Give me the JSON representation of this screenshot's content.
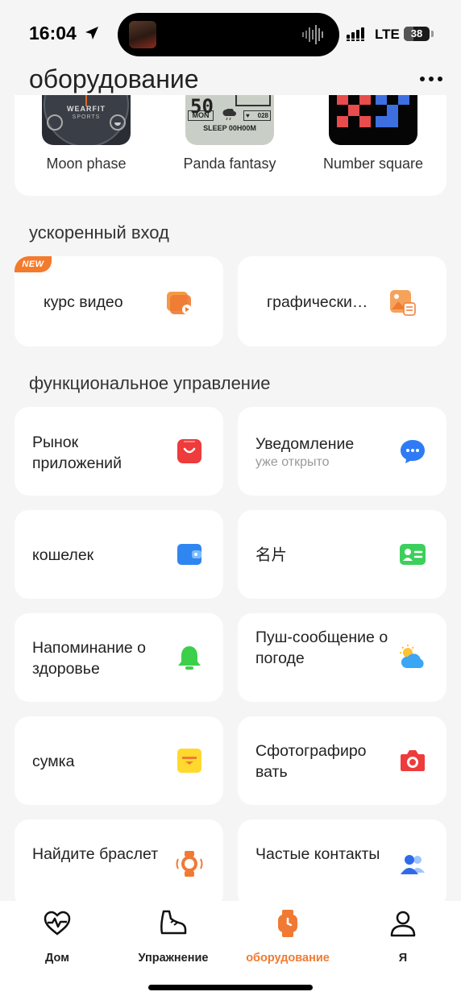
{
  "status": {
    "time": "16:04",
    "network": "LTE",
    "battery": "38",
    "battery_level": 0.38
  },
  "header": {
    "title": "оборудование"
  },
  "watch_faces": [
    {
      "label": "Moon phase",
      "brand": "WEARFIT",
      "sub": "SPORTS"
    },
    {
      "label": "Panda fantasy",
      "digits": "50",
      "day": "MON",
      "num": "028",
      "sleep": "SLEEP 00H00M"
    },
    {
      "label": "Number square"
    }
  ],
  "quick_entry": {
    "title": "ускоренный вход",
    "badge": "NEW",
    "items": [
      {
        "label": "курс видео"
      },
      {
        "label": "графически…"
      }
    ]
  },
  "functions": {
    "title": "функциональное управление",
    "items": [
      {
        "label": "Рынок приложений",
        "icon": "app-market-icon"
      },
      {
        "label": "Уведомление",
        "sub": "уже открыто",
        "icon": "chat-bubble-icon"
      },
      {
        "label": "кошелек",
        "icon": "wallet-icon"
      },
      {
        "label": "名片",
        "icon": "contact-card-icon"
      },
      {
        "label": "Напоминание о здоровье",
        "icon": "bell-icon"
      },
      {
        "label": "Пуш-сообщение о погоде",
        "icon": "weather-icon"
      },
      {
        "label": "сумка",
        "icon": "bag-icon"
      },
      {
        "label": "Сфотографиро вать",
        "icon": "camera-icon"
      },
      {
        "label": "Найдите браслет",
        "icon": "find-watch-icon"
      },
      {
        "label": "Частые контакты",
        "icon": "contacts-icon"
      }
    ]
  },
  "nav": {
    "active": "оборудование",
    "items": [
      {
        "label": "Дом",
        "icon": "heart-pulse-icon"
      },
      {
        "label": "Упражнение",
        "icon": "shoe-icon"
      },
      {
        "label": "оборудование",
        "icon": "watch-icon"
      },
      {
        "label": "Я",
        "icon": "person-icon"
      }
    ]
  },
  "colors": {
    "accent": "#f07a33",
    "background": "#f5f5f5",
    "card": "#ffffff"
  }
}
